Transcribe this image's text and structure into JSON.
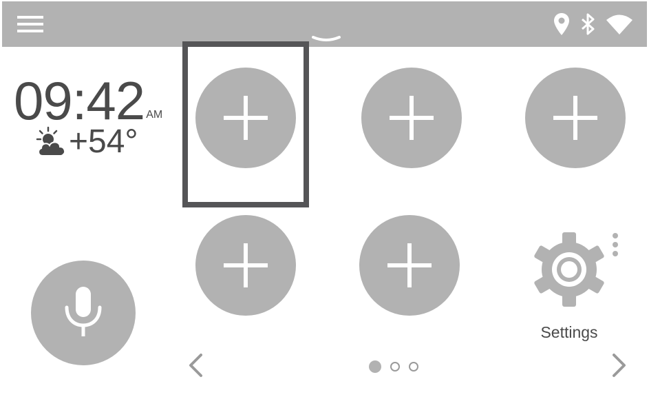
{
  "colors": {
    "topbar": "#b2b2b2",
    "tile": "#b2b2b2",
    "focus_frame": "#555557",
    "text": "#4a4a4a",
    "icon_white": "#ffffff"
  },
  "topbar": {
    "menu_icon": "hamburger-menu-icon",
    "pull_tab_icon": "chevron-down-icon",
    "status_icons": [
      "location-pin-icon",
      "bluetooth-icon",
      "wifi-icon"
    ]
  },
  "clock": {
    "time": "09:42",
    "ampm": "AM"
  },
  "weather": {
    "icon": "partly-cloudy-icon",
    "temperature": "+54°"
  },
  "app_tiles": [
    {
      "icon": "plus-icon",
      "focused": true
    },
    {
      "icon": "plus-icon",
      "focused": false
    },
    {
      "icon": "plus-icon",
      "focused": false
    },
    {
      "icon": "plus-icon",
      "focused": false
    },
    {
      "icon": "plus-icon",
      "focused": false
    }
  ],
  "voice": {
    "icon": "microphone-icon"
  },
  "settings": {
    "label": "Settings",
    "icon": "gear-icon",
    "overflow_icon": "more-vertical-icon"
  },
  "pager": {
    "pages": 3,
    "current": 1,
    "prev_icon": "chevron-left-icon",
    "next_icon": "chevron-right-icon"
  }
}
